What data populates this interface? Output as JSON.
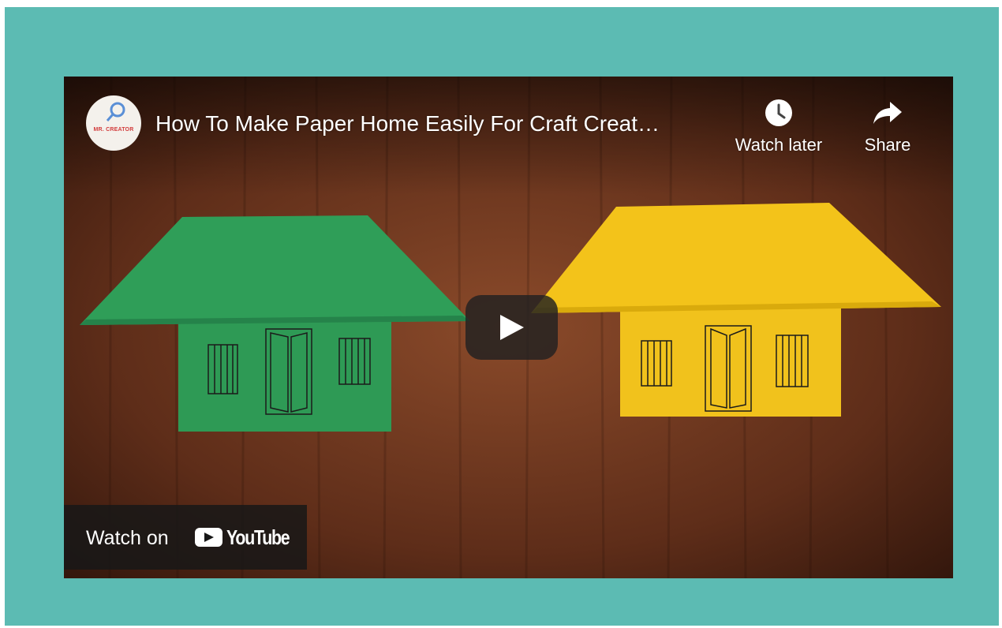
{
  "video": {
    "title": "How To Make Paper Home Easily For Craft Creat…",
    "channel_avatar_text": "MR. CREATOR",
    "watch_later_label": "Watch later",
    "share_label": "Share",
    "watch_on_label": "Watch on",
    "youtube_wordmark": "YouTube"
  },
  "icons": {
    "watch_later": "clock-icon",
    "share": "share-arrow-icon",
    "play": "play-icon",
    "youtube": "youtube-logo-icon"
  },
  "colors": {
    "frame_background": "#5cbbb3",
    "green_house": "#2e9a55",
    "yellow_house": "#f3c31a",
    "wood": "#6b3520"
  }
}
